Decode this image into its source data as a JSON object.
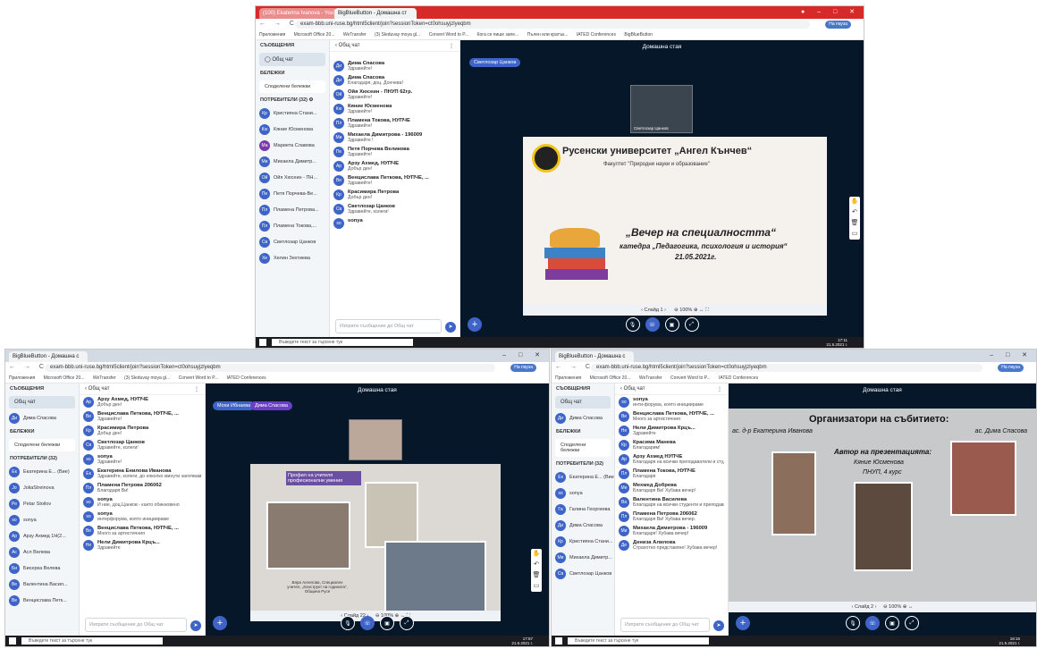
{
  "screens": [
    {
      "tabs": [
        "(100) Ekaterina Ivanova - YouTube",
        "BigBlueButton - Домашна ст"
      ],
      "url": "exam-bbb.uni-ruse.bg/html5client/join?sessionToken=ct0ohsuyjzlyeqbm",
      "room_title": "Домашна стая",
      "presenter_pill": "Светлозар Цанков",
      "slide_label": "Слайд 1",
      "search_placeholder": "Въведете текст за търсене тук",
      "chat_placeholder": "Изпрати съобщение до Общ чат",
      "public_chat": "Общ чат",
      "shared_notes": "Споделени бележки",
      "users_header": "ПОТРЕБИТЕЛИ (32)",
      "clock": "17:11",
      "date": "21.5.2021 г.",
      "users": [
        {
          "i": "Кр",
          "name": "Кристияна Стани...",
          "c": "#3f64c7"
        },
        {
          "i": "Кю",
          "name": "Кяние Юсменова",
          "c": "#3f64c7"
        },
        {
          "i": "Ма",
          "name": "Мариета Славова",
          "c": "#7c3aa8"
        },
        {
          "i": "Ми",
          "name": "Михаела Димитр...",
          "c": "#3f64c7"
        },
        {
          "i": "Ой",
          "name": "Ойя Хюсеин - ПН...",
          "c": "#3f64c7"
        },
        {
          "i": "Пе",
          "name": "Петя Порчева-Ве...",
          "c": "#3f64c7"
        },
        {
          "i": "Пл",
          "name": "Пламена Петрова...",
          "c": "#3f64c7"
        },
        {
          "i": "Пл",
          "name": "Пламена Токова,...",
          "c": "#3f64c7"
        },
        {
          "i": "Св",
          "name": "Светлозар Цанков",
          "c": "#3f64c7"
        },
        {
          "i": "Хе",
          "name": "Хелин Зехтиева",
          "c": "#3f64c7"
        }
      ],
      "messages": [
        {
          "i": "Ди",
          "name": "Дима Спасова",
          "text": "Здравейте!"
        },
        {
          "i": "Ди",
          "name": "Дима Спасова",
          "text": "Благодаря, доц. Дончева!"
        },
        {
          "i": "Ой",
          "name": "Ойя Хюсеин - ПНУП 62гр.",
          "text": "Здравейте!"
        },
        {
          "i": "Кю",
          "name": "Кяние Юсменова",
          "text": "Здравейте!"
        },
        {
          "i": "Пл",
          "name": "Пламена Токова, НУПЧЕ",
          "text": "Здравейте!"
        },
        {
          "i": "Ми",
          "name": "Михаела Димитрова - 196009",
          "text": "Здравейте !"
        },
        {
          "i": "Пе",
          "name": "Петя Порчева Великова",
          "text": "Здравейте!"
        },
        {
          "i": "Ар",
          "name": "Арзу Ахмед, НУПЧЕ",
          "text": "Добър ден!"
        },
        {
          "i": "Ве",
          "name": "Венцислава Петкова, НУПЧЕ, ...",
          "text": "Здравейте!"
        },
        {
          "i": "Кр",
          "name": "Красимира Петрова",
          "text": "Добър ден!"
        },
        {
          "i": "Св",
          "name": "Светлозар Цанков",
          "text": "Здравейте, колеги!"
        },
        {
          "i": "so",
          "name": "sonya",
          "text": ""
        }
      ],
      "slide": {
        "university": "Русенски университет „Ангел Кънчев“",
        "faculty": "Факултет \"Природни науки и образование\"",
        "event": "„Вечер на специалността“",
        "department": "катедра „Педагогика, психология и история“",
        "date": "21.05.2021г."
      },
      "webcam_name": "Светлозар Цанков"
    },
    {
      "room_title": "Домашна стая",
      "slide_label": "Слайд 22",
      "chat_placeholder": "Изпрати съобщение до Общ чат",
      "search_placeholder": "Въведете текст за търсене тук",
      "users_header": "ПОТРЕБИТЕЛИ (32)",
      "public_chat": "Общ чат",
      "private_chat": "Дима Спасова",
      "shared_notes": "Споделени бележки",
      "pills": [
        "Мохи Ибнаева",
        "Дима Спасова"
      ],
      "users": [
        {
          "i": "Ек",
          "name": "Екатерина Е... (Вие)",
          "c": "#3f64c7"
        },
        {
          "i": "Jo",
          "name": "JoliaStreinova",
          "c": "#3f64c7"
        },
        {
          "i": "Pe",
          "name": "Petar Stoilov",
          "c": "#3f64c7"
        },
        {
          "i": "so",
          "name": "sonya",
          "c": "#3f64c7"
        },
        {
          "i": "Ар",
          "name": "Арзу Ахмед 1Н(2...",
          "c": "#3f64c7"
        },
        {
          "i": "Ас",
          "name": "Асл Велева",
          "c": "#3f64c7"
        },
        {
          "i": "Би",
          "name": "Бисерка Велева",
          "c": "#3f64c7"
        },
        {
          "i": "Ве",
          "name": "Валентина Васил...",
          "c": "#3f64c7"
        },
        {
          "i": "Ве",
          "name": "Венцислава Петк...",
          "c": "#3f64c7"
        }
      ],
      "messages": [
        {
          "i": "Ар",
          "name": "Арзу Ахмед, НУПЧЕ",
          "text": "Добър ден!"
        },
        {
          "i": "Ве",
          "name": "Венцислава Петкова, НУПЧЕ, ...",
          "text": "Здравейте!"
        },
        {
          "i": "Кр",
          "name": "Красимира Петрова",
          "text": "Добър ден!"
        },
        {
          "i": "Св",
          "name": "Светлозар Цанков",
          "text": "Здравейте, колеги!"
        },
        {
          "i": "so",
          "name": "sonya",
          "text": "Здравейте!"
        },
        {
          "i": "Ек",
          "name": "Екатерина Енилова Иванова",
          "text": "Здравейте, колеги, до няколко минути започваме!"
        },
        {
          "i": "Пл",
          "name": "Пламена Петрова 206062",
          "text": "Благодаря Ви!"
        },
        {
          "i": "so",
          "name": "sonya",
          "text": "И ние, доц.Цанков - както обикновено"
        },
        {
          "i": "so",
          "name": "sonya",
          "text": "интерфорума, която инициираме"
        },
        {
          "i": "Ве",
          "name": "Венцислава Петкова, НУПЧЕ, ...",
          "text": "Много за артистичния"
        },
        {
          "i": "Не",
          "name": "Нели Димитрова Крцъ...",
          "text": "Здравейте"
        }
      ],
      "slide_caption": "Профил на учителя професионални умения",
      "photo_caption": "Вяра Ангелова, Специален учител, „Конструкт на годината“, Община Русе",
      "clock": "17:57",
      "date": "21.5.2021 г."
    },
    {
      "room_title": "Домашна стая",
      "slide_label": "Слайд 2",
      "chat_placeholder": "Изпрати съобщение до Общ чат",
      "search_placeholder": "Въведете текст за търсене тук",
      "users_header": "ПОТРЕБИТЕЛИ (32)",
      "public_chat": "Общ чат",
      "private_chat": "Дима Спасова",
      "shared_notes": "Споделени бележки",
      "users": [
        {
          "i": "Ек",
          "name": "Екатерина Е... (Вие)",
          "c": "#3f64c7"
        },
        {
          "i": "so",
          "name": "sonya",
          "c": "#3f64c7"
        },
        {
          "i": "Га",
          "name": "Галина Георгиева",
          "c": "#3f64c7"
        },
        {
          "i": "Ди",
          "name": "Дима Спасова",
          "c": "#3f64c7"
        },
        {
          "i": "Кр",
          "name": "Кристияна Стани...",
          "c": "#3f64c7"
        },
        {
          "i": "Ми",
          "name": "Михаела Димитр...",
          "c": "#3f64c7"
        },
        {
          "i": "Св",
          "name": "Светлозар Цанков",
          "c": "#3f64c7"
        }
      ],
      "messages": [
        {
          "i": "so",
          "name": "sonya",
          "text": "инти-форума, която инициираме"
        },
        {
          "i": "Ве",
          "name": "Венцислава Петкова, НУПЧЕ, ...",
          "text": "Много за артистичния"
        },
        {
          "i": "Не",
          "name": "Нели Димитрова Крцъ...",
          "text": "Здравейте"
        },
        {
          "i": "Кр",
          "name": "Красима Манева",
          "text": "Благодарим!"
        },
        {
          "i": "Ар",
          "name": "Арзу Ахмед НУПЧЕ",
          "text": "Благодаря на всички преподаватели и студенти"
        },
        {
          "i": "Пл",
          "name": "Пламена Токова, НУПЧЕ",
          "text": "Благодаря"
        },
        {
          "i": "Ме",
          "name": "Мехмед Добрева",
          "text": "Благодаря Ви! Хубава вечер!"
        },
        {
          "i": "Ва",
          "name": "Валентина Василева",
          "text": "Благодаря на всички студенти и преподаватели за участието! Хубава вечер!"
        },
        {
          "i": "Пл",
          "name": "Пламена Петрова 206062",
          "text": "Благодаря Ви! Хубава вечер."
        },
        {
          "i": "Ми",
          "name": "Михаела Димитрова - 196009",
          "text": "Благодаря! Хубава вечер!"
        },
        {
          "i": "Де",
          "name": "Дениза Алилова",
          "text": "Страхотно представяне! Хубава вечер!"
        }
      ],
      "slide": {
        "heading": "Организатори на събитието:",
        "left_name": "ас. д-р Екатерина Иванова",
        "right_name": "ас. Дима Спасова",
        "author_label": "Автор на презентацията:",
        "author_name": "Кяние Юсменова",
        "author_year": "ПНУП, 4 курс"
      },
      "clock": "18:15",
      "date": "21.5.2021 г."
    }
  ]
}
